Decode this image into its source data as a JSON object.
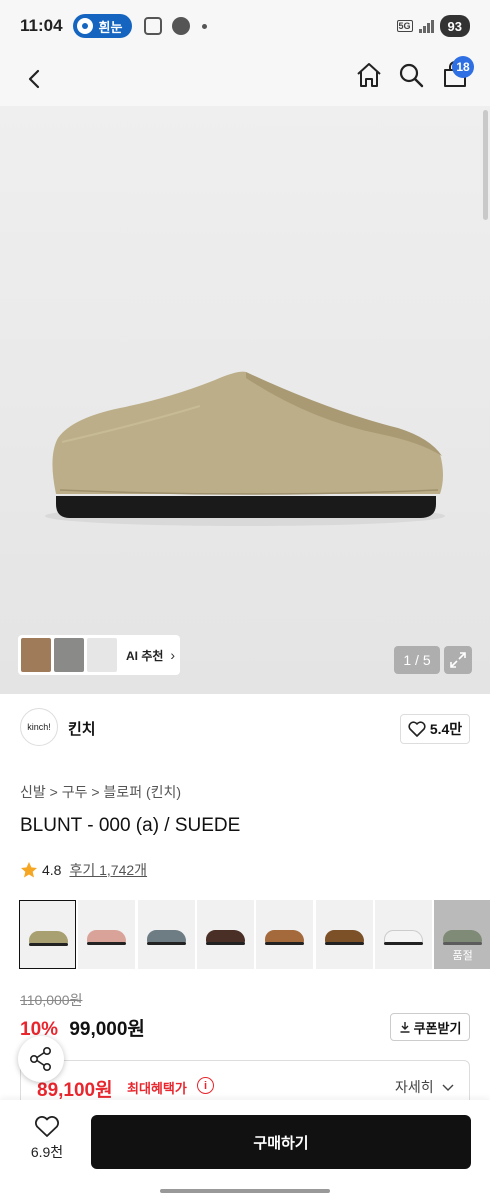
{
  "status": {
    "time": "11:04",
    "pill_label": "흰눈",
    "network": "5G",
    "battery": "93"
  },
  "nav": {
    "cart_count": "18"
  },
  "gallery": {
    "counter": "1 / 5",
    "ai_label": "AI 추천",
    "thumb_colors": [
      "#a07b5a",
      "#8a8a88",
      "#e6e6e6"
    ]
  },
  "brand": {
    "logo_text": "kinch!",
    "name": "킨치",
    "likes": "5.4만"
  },
  "breadcrumb": "신발 > 구두 > 블로퍼 (킨치)",
  "product": {
    "title": "BLUNT - 000 (a) / SUEDE",
    "rating": "4.8",
    "reviews": "후기 1,742개"
  },
  "swatches": [
    {
      "color": "#a8a070",
      "selected": true,
      "sold_out": false
    },
    {
      "color": "#d9a39a",
      "selected": false,
      "sold_out": false
    },
    {
      "color": "#6e7c84",
      "selected": false,
      "sold_out": false
    },
    {
      "color": "#4a2f26",
      "selected": false,
      "sold_out": false
    },
    {
      "color": "#a46a3c",
      "selected": false,
      "sold_out": false
    },
    {
      "color": "#7c5128",
      "selected": false,
      "sold_out": false
    },
    {
      "color": "#f4f4f4",
      "selected": false,
      "sold_out": false
    },
    {
      "color": "#6f8a5c",
      "selected": false,
      "sold_out": true,
      "sold_label": "품절"
    }
  ],
  "price": {
    "original": "110,000원",
    "discount": "10%",
    "sale": "99,000원",
    "coupon": "쿠폰받기"
  },
  "benefit": {
    "price": "89,100원",
    "label": "최대혜택가",
    "detail": "자세히"
  },
  "bottom": {
    "wish_count": "6.9천",
    "buy_label": "구매하기"
  },
  "colors": {
    "accent_red": "#e8262e",
    "badge_blue": "#2f6fe4",
    "shoe_beige": "#bcae88"
  }
}
